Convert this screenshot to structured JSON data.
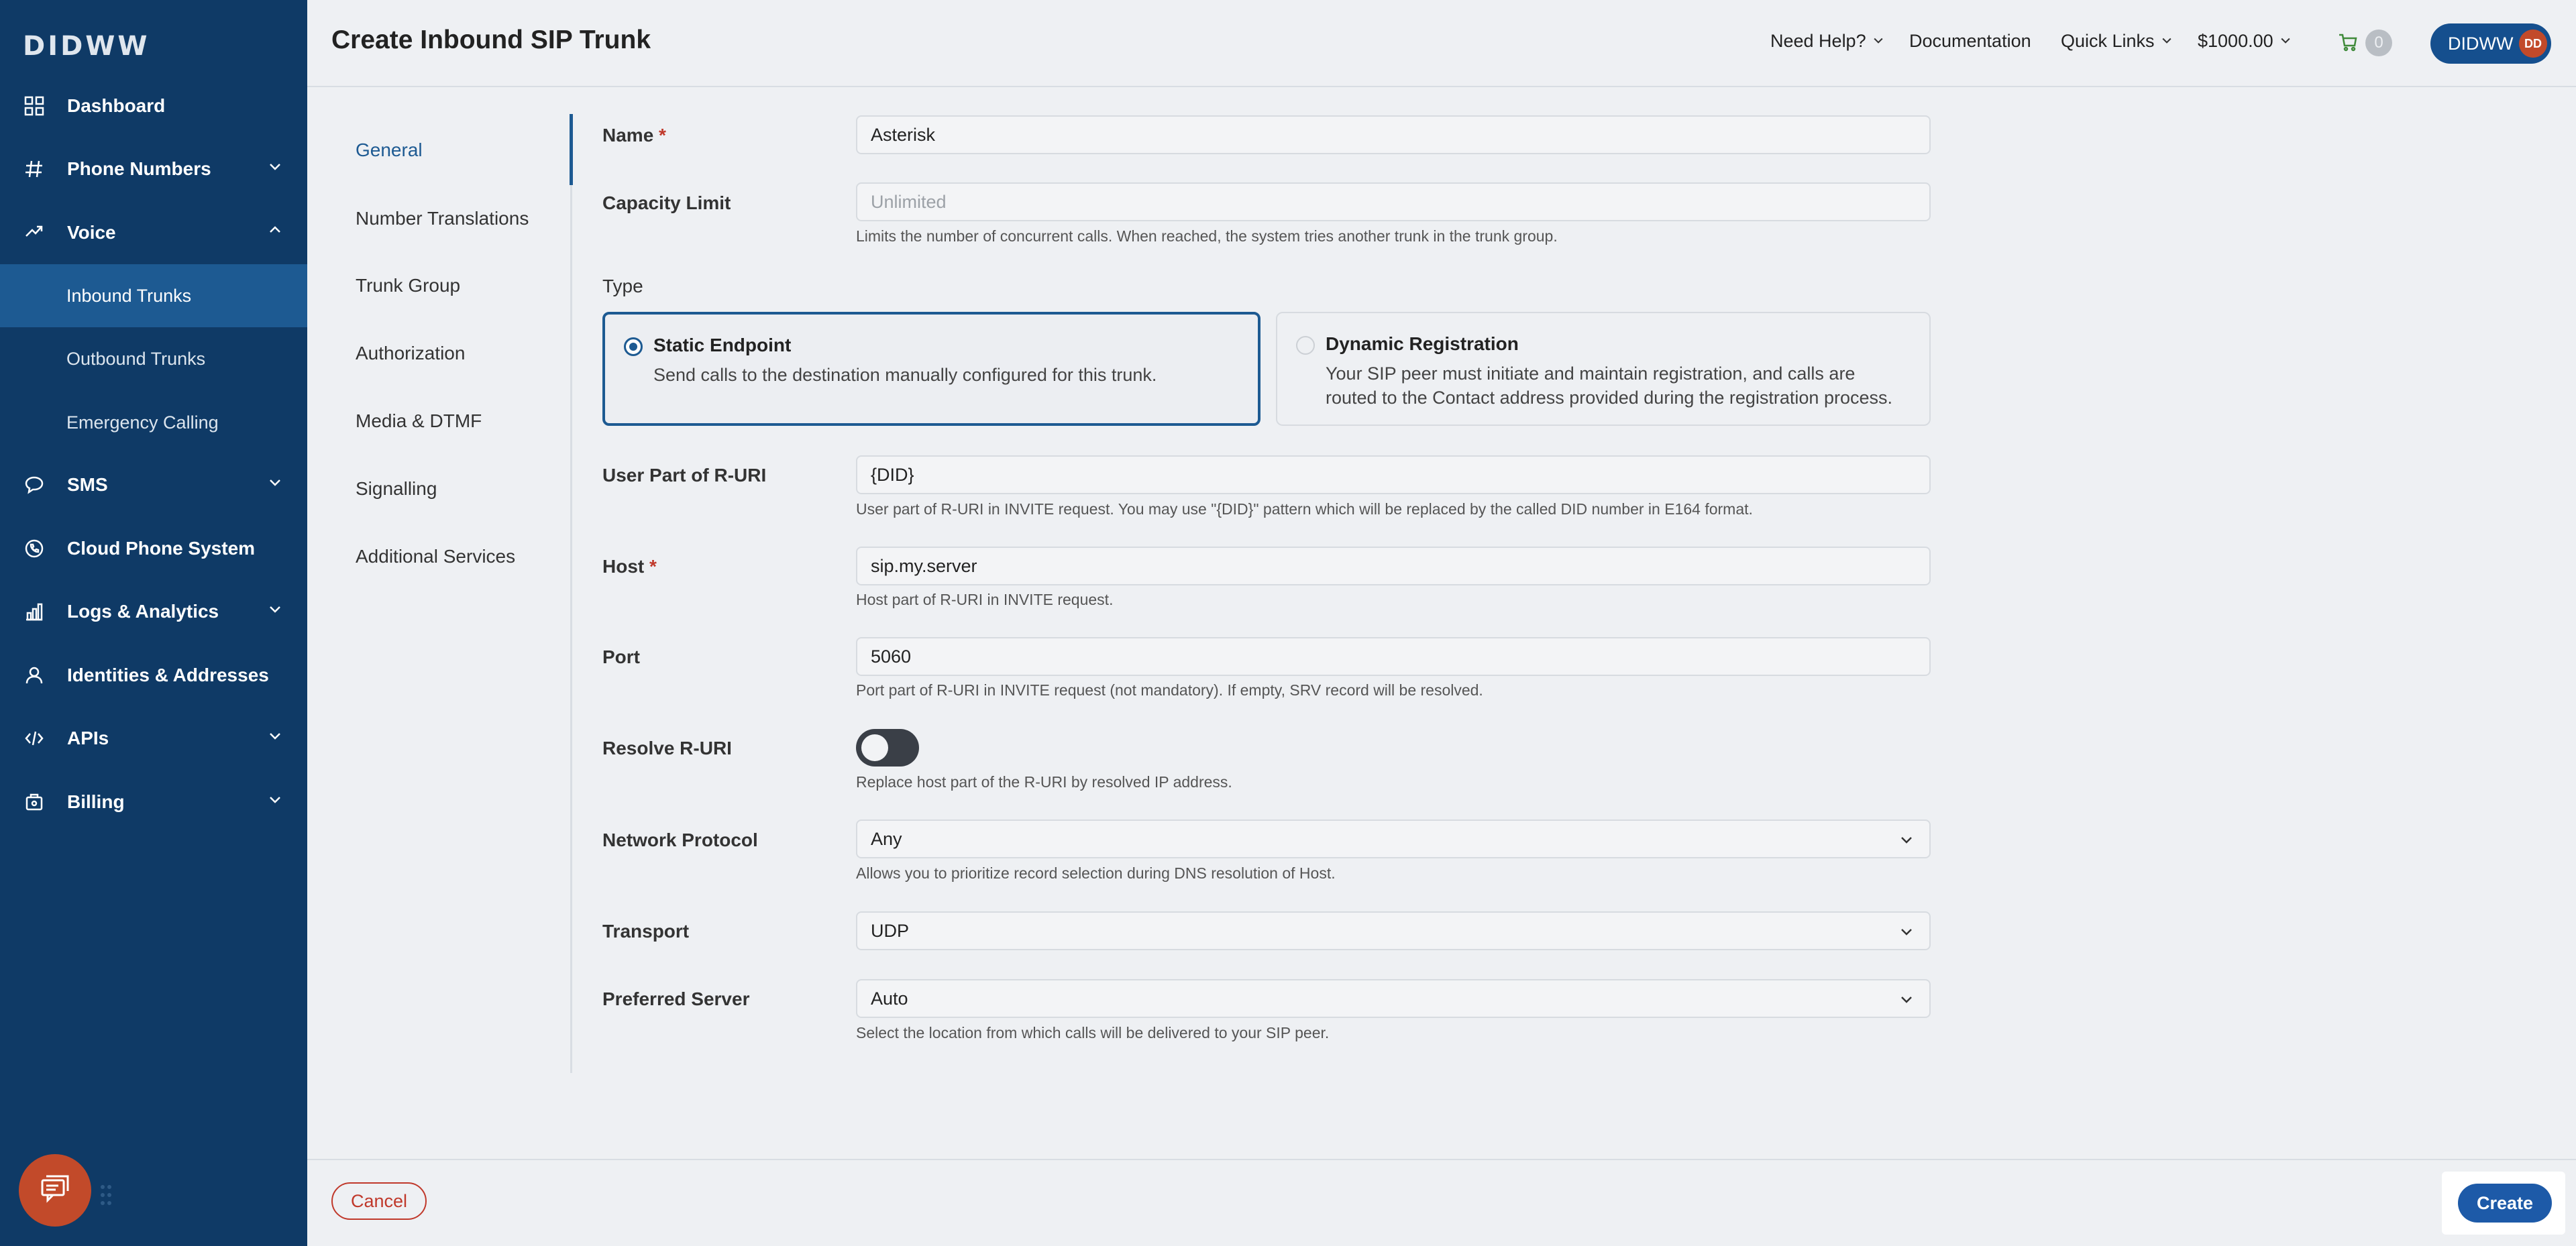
{
  "brand": {
    "logo": "DIDWW"
  },
  "sidebar": {
    "items": [
      {
        "label": "Dashboard",
        "icon": "grid-icon"
      },
      {
        "label": "Phone Numbers",
        "icon": "hash-icon"
      },
      {
        "label": "Voice",
        "icon": "voice-icon"
      },
      {
        "label": "Inbound Trunks"
      },
      {
        "label": "Outbound Trunks"
      },
      {
        "label": "Emergency Calling"
      },
      {
        "label": "SMS",
        "icon": "chat-icon"
      },
      {
        "label": "Cloud Phone System",
        "icon": "phone-icon"
      },
      {
        "label": "Logs & Analytics",
        "icon": "bar-chart-icon"
      },
      {
        "label": "Identities & Addresses",
        "icon": "user-icon"
      },
      {
        "label": "APIs",
        "icon": "code-icon"
      },
      {
        "label": "Billing",
        "icon": "billing-icon"
      }
    ]
  },
  "header": {
    "title": "Create Inbound SIP Trunk",
    "need_help": "Need Help?",
    "documentation": "Documentation",
    "quick_links": "Quick Links",
    "balance": "$1000.00",
    "cart_count": "0",
    "account": "DIDWW",
    "avatar_initials": "DD"
  },
  "subnav": {
    "items": [
      "General",
      "Number Translations",
      "Trunk Group",
      "Authorization",
      "Media & DTMF",
      "Signalling",
      "Additional Services"
    ]
  },
  "form": {
    "name_label": "Name",
    "name_value": "Asterisk",
    "capacity_label": "Capacity Limit",
    "capacity_placeholder": "Unlimited",
    "capacity_help": "Limits the number of concurrent calls. When reached, the system tries another trunk in the trunk group.",
    "type_label": "Type",
    "static_title": "Static Endpoint",
    "static_desc": "Send calls to the destination manually configured for this trunk.",
    "dynamic_title": "Dynamic Registration",
    "dynamic_desc": "Your SIP peer must initiate and maintain registration, and calls are routed to the Contact address provided during the registration process.",
    "ruri_label": "User Part of R-URI",
    "ruri_value": "{DID}",
    "ruri_help": "User part of R-URI in INVITE request. You may use \"{DID}\" pattern which will be replaced by the called DID number in E164 format.",
    "host_label": "Host",
    "host_value": "sip.my.server",
    "host_help": "Host part of R-URI in INVITE request.",
    "port_label": "Port",
    "port_value": "5060",
    "port_help": "Port part of R-URI in INVITE request (not mandatory). If empty, SRV record will be resolved.",
    "resolve_label": "Resolve R-URI",
    "resolve_help": "Replace host part of the R-URI by resolved IP address.",
    "resolve_on": false,
    "protocol_label": "Network Protocol",
    "protocol_value": "Any",
    "protocol_help": "Allows you to prioritize record selection during DNS resolution of Host.",
    "transport_label": "Transport",
    "transport_value": "UDP",
    "server_label": "Preferred Server",
    "server_value": "Auto",
    "server_help": "Select the location from which calls will be delivered to your SIP peer.",
    "required_mark": "*"
  },
  "footer": {
    "cancel": "Cancel",
    "create": "Create"
  },
  "colors": {
    "sidebar": "#0f3a66",
    "accent": "#1d5a92",
    "danger": "#c0392b",
    "create": "#1d5aa8"
  }
}
